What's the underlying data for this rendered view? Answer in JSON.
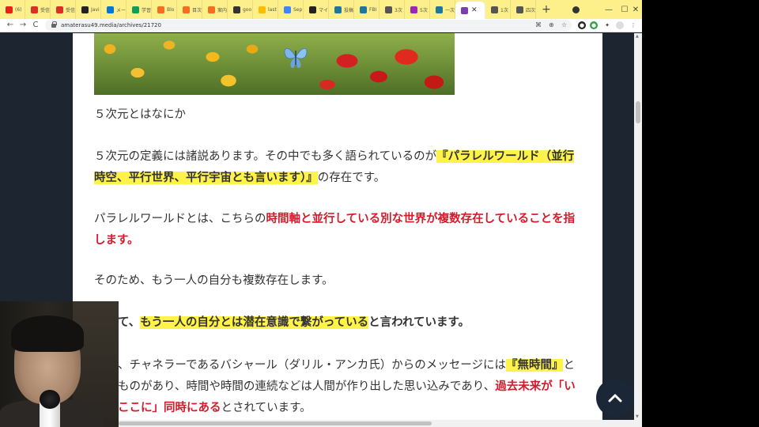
{
  "tabs": [
    {
      "title": "(6)",
      "color": "#e62117"
    },
    {
      "title": "受信",
      "color": "#d93025"
    },
    {
      "title": "受信",
      "color": "#d93025"
    },
    {
      "title": "Javi",
      "color": "#222222"
    },
    {
      "title": "メー",
      "color": "#0078d4"
    },
    {
      "title": "学習",
      "color": "#0f9d58"
    },
    {
      "title": "Blo",
      "color": "#f26f21"
    },
    {
      "title": "目次",
      "color": "#f26f21"
    },
    {
      "title": "案内",
      "color": "#f26f21"
    },
    {
      "title": "goo",
      "color": "#333333"
    },
    {
      "title": "last",
      "color": "#fbbc04"
    },
    {
      "title": "Sep",
      "color": "#4285f4"
    },
    {
      "title": "マイ",
      "color": "#222222"
    },
    {
      "title": "投稿",
      "color": "#21759b"
    },
    {
      "title": "FBI",
      "color": "#21759b"
    },
    {
      "title": "3次",
      "color": "#555555"
    },
    {
      "title": "5次",
      "color": "#9c27b0"
    },
    {
      "title": "一次",
      "color": "#21759b"
    }
  ],
  "active_tab": {
    "title": "",
    "close": "✕",
    "color": "#7b3fb0"
  },
  "tabs_after": [
    {
      "title": "1次",
      "color": "#555555"
    },
    {
      "title": "四次",
      "color": "#555555"
    }
  ],
  "new_tab": "+",
  "window_controls": {
    "minimize": "—",
    "maximize": "☐",
    "close": "✕"
  },
  "toolbar": {
    "back": "←",
    "forward": "→",
    "reload": "C",
    "url": "amaterasu49.media/archives/21720"
  },
  "article": {
    "p1": "５次元とはなにか",
    "p2_a": "５次元の定義には諸説あります。その中でも多く語られているのが",
    "p2_hl": "『パラレルワールド（並行時空、平行世界、平行宇宙とも言います）』",
    "p2_b": "の存在です。",
    "p3_a": "パラレルワールドとは、こちらの",
    "p3_red": "時間軸と並行している別な世界が複数存在していることを指します。",
    "p4": "そのため、もう一人の自分も複数存在します。",
    "p5_a": "て、",
    "p5_hl": "もう一人の自分とは潜在意識で繋がっている",
    "p5_b": "と言われています。",
    "p6_a": "、チャネラーであるバシャール（ダリル・アンカ氏）からのメッセージには",
    "p6_hl": "『無時間』",
    "p6_b": "と",
    "p6_c": "ものがあり、時間や時間の連続などは人間が作り出した思い込みであり、",
    "p6_red1": "過去未来が「い",
    "p6_red2": "ここに」同時にある",
    "p6_d": "とされています。"
  },
  "back_to_top": "^"
}
